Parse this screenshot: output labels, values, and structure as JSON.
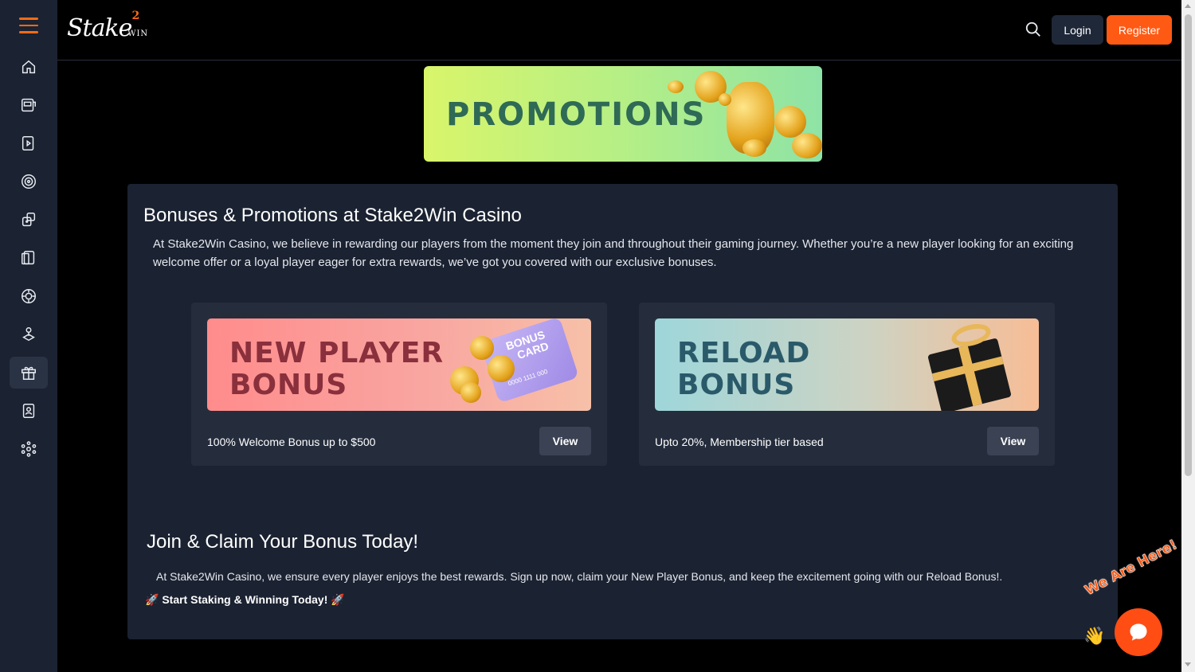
{
  "sidebar": {
    "menu_icon": "hamburger-icon",
    "items": [
      {
        "icon": "home-icon",
        "active": false
      },
      {
        "icon": "slot-machine-icon",
        "active": false
      },
      {
        "icon": "live-casino-icon",
        "active": false
      },
      {
        "icon": "roulette-icon",
        "active": false
      },
      {
        "icon": "dice-icon",
        "active": false
      },
      {
        "icon": "cards-icon",
        "active": false
      },
      {
        "icon": "poker-chip-icon",
        "active": false
      },
      {
        "icon": "crash-game-icon",
        "active": false
      },
      {
        "icon": "gift-icon",
        "active": true
      },
      {
        "icon": "profile-card-icon",
        "active": false
      },
      {
        "icon": "network-icon",
        "active": false
      }
    ]
  },
  "header": {
    "logo_text": "Stake",
    "logo_sup": "2",
    "logo_small": "WIN",
    "login_label": "Login",
    "register_label": "Register"
  },
  "banner": {
    "title": "PROMOTIONS"
  },
  "content": {
    "title": "Bonuses & Promotions at Stake2Win Casino",
    "intro": "At Stake2Win Casino, we believe in rewarding our players from the moment they join and throughout their gaming journey. Whether you’re a new player looking for an exciting welcome offer or a loyal player eager for extra rewards, we’ve got you covered with our exclusive bonuses.",
    "cards": [
      {
        "image_line1": "NEW PLAYER",
        "image_line2": "BONUS",
        "card_text_1": "BONUS",
        "card_text_2": "CARD",
        "card_number": "0000 1111 000",
        "description": "100% Welcome Bonus up to $500",
        "button": "View"
      },
      {
        "image_line1": "RELOAD",
        "image_line2": "BONUS",
        "description": "Upto 20%, Membership tier based",
        "button": "View"
      }
    ],
    "claim_title": "Join & Claim Your Bonus Today!",
    "claim_text": "At Stake2Win Casino, we ensure every player enjoys the best rewards. Sign up now, claim your New Player Bonus, and keep the excitement going with our Reload Bonus!.",
    "cta_text": "🚀 Start Staking & Winning Today! 🚀"
  },
  "chat": {
    "tag": "We Are Here!",
    "icon": "chat-bubble-icon"
  },
  "colors": {
    "accent": "#ff5a14",
    "sidebar_bg": "#1b2231",
    "panel_bg": "#1b2231",
    "card_bg": "#252d3d"
  }
}
